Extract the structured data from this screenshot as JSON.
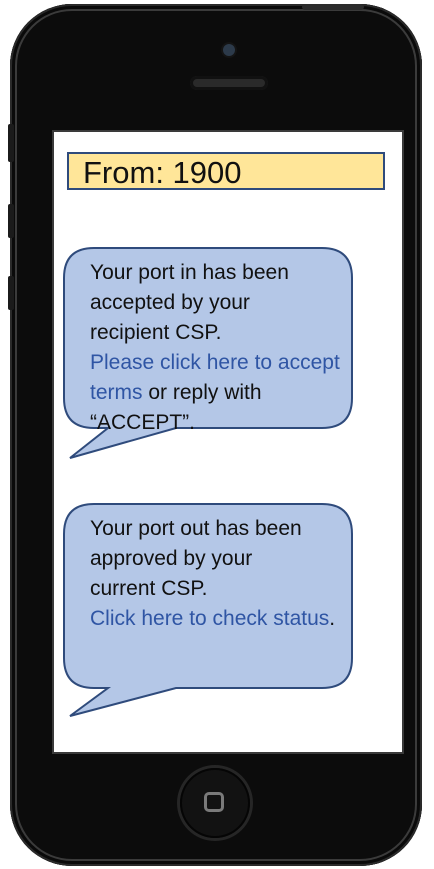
{
  "header": {
    "from_text": "From: 1900"
  },
  "messages": [
    {
      "lines": [
        "Your port in has been",
        "accepted by your",
        "recipient CSP."
      ],
      "link_text": "Please click here to accept terms",
      "after_text": " or reply with “ACCEPT”."
    },
    {
      "lines": [
        "Your port out has been",
        "approved by your",
        "current CSP."
      ],
      "link_text": "Click here to check status",
      "after_text": "."
    }
  ],
  "colors": {
    "bubble_fill": "#b4c7e7",
    "bubble_border": "#2f4b7c",
    "link": "#2f55a4",
    "header_fill": "#ffe699"
  }
}
